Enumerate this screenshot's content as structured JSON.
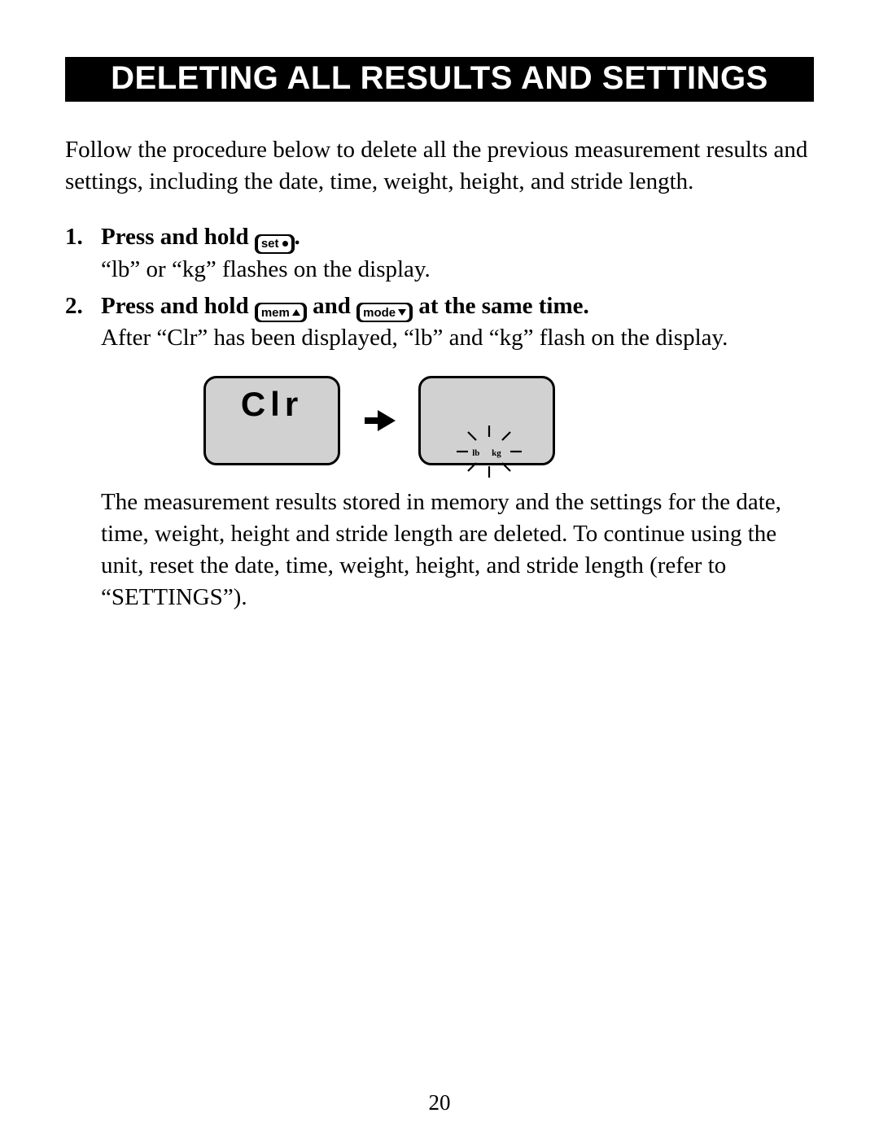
{
  "title": "DELETING ALL RESULTS AND SETTINGS",
  "intro": "Follow the procedure below to delete all the previous measurement results and settings, including the date, time, weight, height, and stride length.",
  "buttons": {
    "set": {
      "label": "set",
      "icon": "dot"
    },
    "mem": {
      "label": "mem",
      "icon": "up"
    },
    "mode": {
      "label": "mode",
      "icon": "down"
    }
  },
  "steps": [
    {
      "title_before": "Press and hold ",
      "title_button_ref": "set",
      "title_after": ".",
      "body": "“lb” or “kg” flashes on the display."
    },
    {
      "title_before": "Press and hold ",
      "title_button_ref": "mem",
      "title_mid": " and ",
      "title_button_ref2": "mode",
      "title_after": " at the same time.",
      "body": "After “Clr” has been displayed, “lb” and “kg” flash on the display."
    }
  ],
  "diagram": {
    "screen1_text": "Clr",
    "screen2_units": {
      "left": "lb",
      "right": "kg"
    }
  },
  "closing": "The measurement results stored in memory and the settings for the date, time, weight, height and stride length are deleted. To continue using the unit, reset the date, time, weight, height, and stride length (refer to “SETTINGS”).",
  "page_number": "20"
}
